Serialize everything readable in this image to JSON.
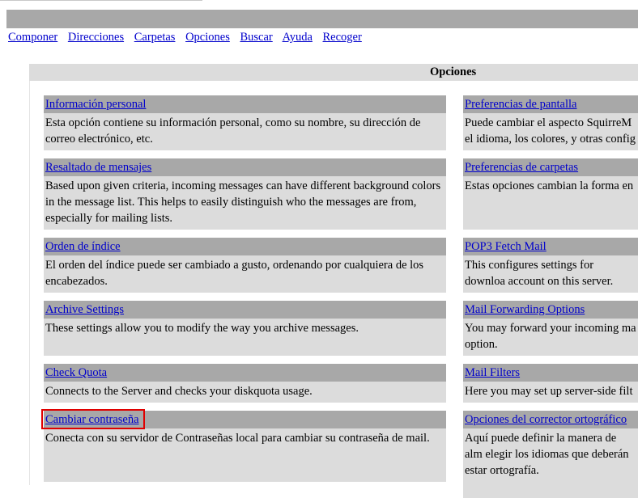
{
  "menu": [
    {
      "label": "Componer"
    },
    {
      "label": "Direcciones"
    },
    {
      "label": "Carpetas"
    },
    {
      "label": "Opciones"
    },
    {
      "label": "Buscar"
    },
    {
      "label": "Ayuda"
    },
    {
      "label": "Recoger"
    }
  ],
  "options_title": "Opciones",
  "left_column": [
    {
      "title": "Información personal",
      "desc": "Esta opción contiene su información personal, como su nombre, su dirección de correo electrónico, etc."
    },
    {
      "title": "Resaltado de mensajes",
      "desc": "Based upon given criteria, incoming messages can have different background colors in the message list. This helps to easily distinguish who the messages are from, especially for mailing lists."
    },
    {
      "title": "Orden de índice",
      "desc": "El orden del índice puede ser cambiado a gusto, ordenando por cualquiera de los encabezados."
    },
    {
      "title": "Archive Settings",
      "desc": "These settings allow you to modify the way you archive messages."
    },
    {
      "title": "Check Quota",
      "desc": "Connects to the Server and checks your diskquota usage."
    },
    {
      "title": "Cambiar contraseña",
      "desc": "Conecta con su servidor de Contraseñas local para cambiar su contraseña de mail."
    }
  ],
  "right_column": [
    {
      "title": "Preferencias de pantalla",
      "desc": "Puede cambiar el aspecto SquirreM el idioma, los colores, y otras config"
    },
    {
      "title": "Preferencias de carpetas",
      "desc": "Estas opciones cambian la forma en"
    },
    {
      "title": "POP3 Fetch Mail",
      "desc": "This configures settings for downloa account on this server."
    },
    {
      "title": "Mail Forwarding Options",
      "desc": "You may forward your incoming ma option."
    },
    {
      "title": "Mail Filters",
      "desc": "Here you may set up server-side filt"
    },
    {
      "title": "Opciones del corrector ortográfico",
      "desc": "Aquí puede definir la manera de alm elegir los idiomas que deberán estar ortografía."
    }
  ]
}
